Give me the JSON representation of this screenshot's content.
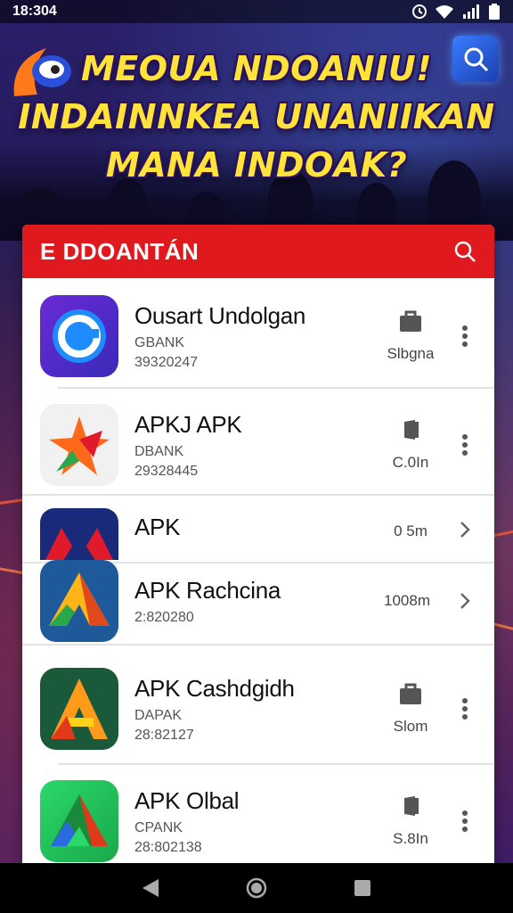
{
  "status_bar": {
    "time": "18:304"
  },
  "headline": {
    "line1": "MEOUA NDOANIU!",
    "line2": "INDAINNKEA UNANIIKAN",
    "line3": "MANA INDOAK?"
  },
  "panel": {
    "title": "E DDOANTÁN"
  },
  "apps": [
    {
      "name": "Ousart Undolgan",
      "sub": "GBANK",
      "meta": "39320247",
      "side": "Slbgna",
      "action_icon": "bag-icon",
      "menu_icon": "more-vert-icon"
    },
    {
      "name": "APKJ APK",
      "sub": "DBANK",
      "meta": "29328445",
      "side": "C.0In",
      "action_icon": "door-icon",
      "menu_icon": "more-vert-icon"
    },
    {
      "name": "APK",
      "sub": "",
      "meta": "",
      "side": "0 5m",
      "action_icon": "",
      "menu_icon": "chevron-right-icon"
    },
    {
      "name": "APK Rachcina",
      "sub": "",
      "meta": "2:820280",
      "side": "1008m",
      "action_icon": "",
      "menu_icon": "chevron-right-icon"
    },
    {
      "name": "APK Cashdgidh",
      "sub": "DAPAK",
      "meta": "28:82127",
      "side": "Slom",
      "action_icon": "bag-icon",
      "menu_icon": "more-vert-icon"
    },
    {
      "name": "APK Olbal",
      "sub": "CPANK",
      "meta": "28:802138",
      "side": "S.8In",
      "action_icon": "door-icon",
      "menu_icon": "more-vert-icon"
    }
  ],
  "colors": {
    "header_red": "#e0191f",
    "headline_yellow": "#ffe23a"
  }
}
